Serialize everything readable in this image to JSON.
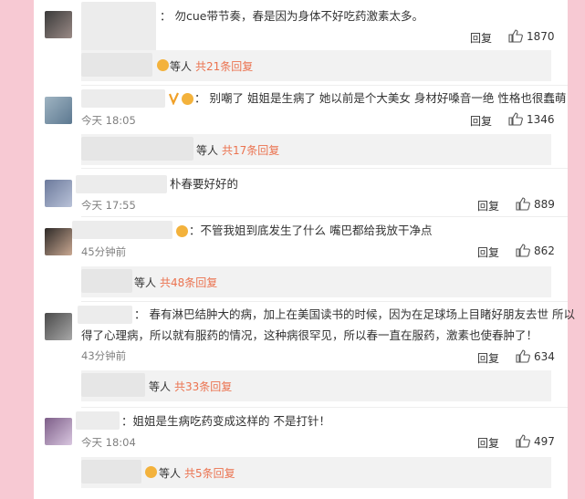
{
  "comments": [
    {
      "text": "：   勿cue带节奏，春是因为身体不好吃药激素太多。",
      "time": "",
      "reply": "回复",
      "likes": "1870",
      "sub": {
        "prefix": "等人",
        "count": "共21条回复"
      }
    },
    {
      "text": "：  别嘲了 姐姐是生病了 她以前是个大美女 身材好嗓音一绝 性格也很蠢萌",
      "time": "今天 18:05",
      "reply": "回复",
      "likes": "1346",
      "sub": {
        "prefix": "等人",
        "count": "共17条回复"
      }
    },
    {
      "text": "朴春要好好的",
      "time": "今天 17:55",
      "reply": "回复",
      "likes": "889"
    },
    {
      "text": "：不管我姐到底发生了什么    嘴巴都给我放干净点",
      "time": "45分钟前",
      "reply": "回复",
      "likes": "862",
      "sub": {
        "prefix": "等人",
        "count": "共48条回复"
      }
    },
    {
      "text_line1": "：  春有淋巴结肿大的病，加上在美国读书的时候，因为在足球场上目睹好朋友去世 所以",
      "text_line2": "得了心理病，所以就有服药的情况，这种病很罕见，所以春一直在服药，激素也使春肿了！",
      "time": "43分钟前",
      "reply": "回复",
      "likes": "634",
      "sub": {
        "prefix": "等人",
        "count": "共33条回复"
      }
    },
    {
      "text": "：姐姐是生病吃药变成这样的 不是打针！",
      "time": "今天 18:04",
      "reply": "回复",
      "likes": "497",
      "sub": {
        "prefix": "等人",
        "count": "共5条回复"
      }
    }
  ]
}
